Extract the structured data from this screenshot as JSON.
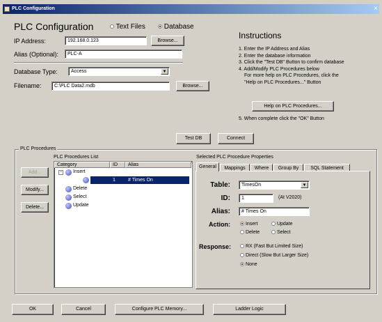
{
  "window": {
    "title": "PLC Configuration",
    "close_glyph": "×"
  },
  "header": {
    "title": "PLC Configuration",
    "mode_options": [
      "Text Files",
      "Database"
    ],
    "mode_selected": "Database"
  },
  "connection": {
    "ip_label": "IP Address:",
    "ip_value": "192.168.0.123",
    "alias_label": "Alias (Optional):",
    "alias_value": "PLC-A",
    "browse_label": "Browse..."
  },
  "database": {
    "type_label": "Database Type:",
    "type_value": "Access",
    "filename_label": "Filename:",
    "filename_value": "C:\\PLC Data2.mdb",
    "browse_label": "Browse..."
  },
  "instructions": {
    "title": "Instructions",
    "steps": [
      "1. Enter the IP Address and Alias",
      "2. Enter the database information",
      "3. Click the \"Test DB\" Button to confirm database",
      "4. Add/Modify PLC Procedures below",
      "For more help on PLC Procedures, click the",
      "\"Help on PLC Procedures...\" Button"
    ],
    "help_button": "Help on PLC Procedures...",
    "step5": "5. When complete click the \"OK\" Button"
  },
  "actions": {
    "test_db": "Test DB",
    "connect": "Connect"
  },
  "procedures": {
    "group_label": "PLC Procedures",
    "list_title": "PLC Procedures List",
    "buttons": {
      "add": "Add...",
      "modify": "Modify...",
      "delete": "Delete..."
    },
    "columns": [
      "Category",
      "ID",
      "Alias"
    ],
    "tree": {
      "insert_label": "Insert",
      "selected_id": "1",
      "selected_alias": "# Times On",
      "others": [
        "Delete",
        "Select",
        "Update"
      ]
    }
  },
  "properties": {
    "title": "Selected PLC Procedure Properties",
    "tabs": [
      "General",
      "Mappings",
      "Where",
      "Group By",
      "SQL Statement"
    ],
    "table_label": "Table:",
    "table_value": "TimesOn",
    "id_label": "ID:",
    "id_value": "1",
    "address": "(At V2020)",
    "alias_label": "Alias:",
    "alias_value": "# Times On",
    "action_label": "Action:",
    "actions": [
      "Insert",
      "Update",
      "Delete",
      "Select"
    ],
    "action_selected": "Insert",
    "response_label": "Response:",
    "responses": [
      "RX (Fast But Limited Size)",
      "Direct (Slow But Larger Size)",
      "None"
    ],
    "response_selected": "None"
  },
  "footer": {
    "ok": "OK",
    "cancel": "Cancel",
    "configure": "Configure PLC Memory...",
    "ladder": "Ladder Logic"
  }
}
